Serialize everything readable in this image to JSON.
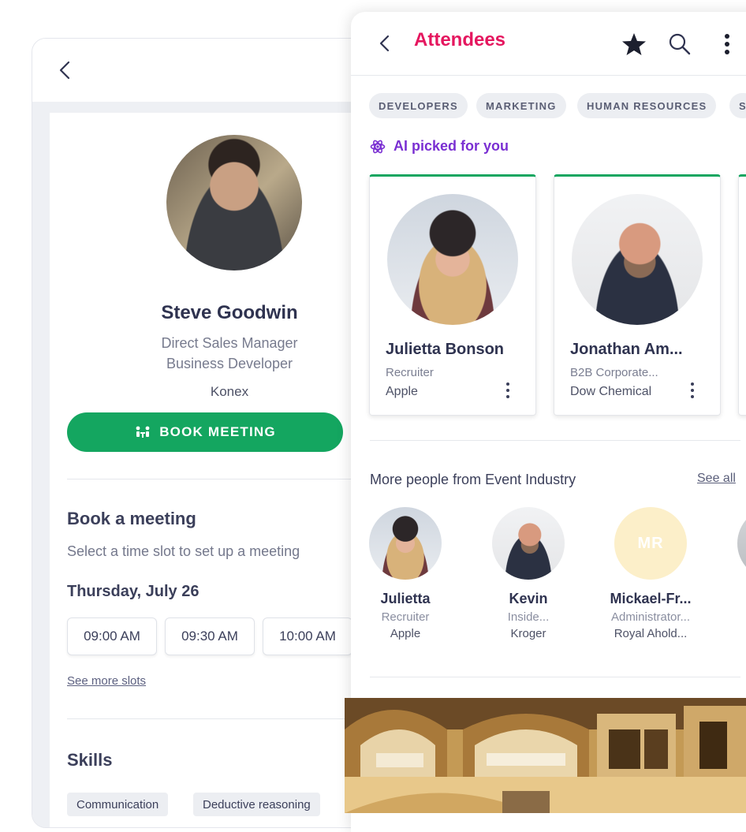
{
  "profile": {
    "name": "Steve Goodwin",
    "role_line1": "Direct Sales Manager",
    "role_line2": "Business Developer",
    "company": "Konex",
    "book_button": "BOOK MEETING",
    "book_section_title": "Book a meeting",
    "book_section_subtitle": "Select a time slot to set up a meeting",
    "date": "Thursday, July 26",
    "slots": [
      "09:00 AM",
      "09:30 AM",
      "10:00 AM"
    ],
    "see_more_slots": "See more slots",
    "skills_title": "Skills",
    "skills": [
      "Communication",
      "Deductive reasoning"
    ]
  },
  "attendees": {
    "title": "Attendees",
    "accent_color": "#e5175f",
    "filters": [
      "DEVELOPERS",
      "MARKETING",
      "HUMAN RESOURCES",
      "S"
    ],
    "ai_label": "AI picked for you",
    "ai_cards": [
      {
        "name": "Julietta Bonson",
        "role": "Recruiter",
        "company": "Apple"
      },
      {
        "name": "Jonathan Am...",
        "role": "B2B Corporate...",
        "company": "Dow Chemical"
      }
    ],
    "more_title": "More people from Event Industry",
    "see_all": "See all",
    "people": [
      {
        "name": "Julietta",
        "role": "Recruiter",
        "company": "Apple"
      },
      {
        "name": "Kevin",
        "role": "Inside...",
        "company": "Kroger"
      },
      {
        "name": "Mickael-Fr...",
        "role": "Administrator...",
        "company": "Royal Ahold...",
        "initials": "MR"
      }
    ]
  },
  "colors": {
    "primary_green": "#14a660",
    "ai_purple": "#7a2fd2",
    "text_dark": "#2f3350"
  }
}
